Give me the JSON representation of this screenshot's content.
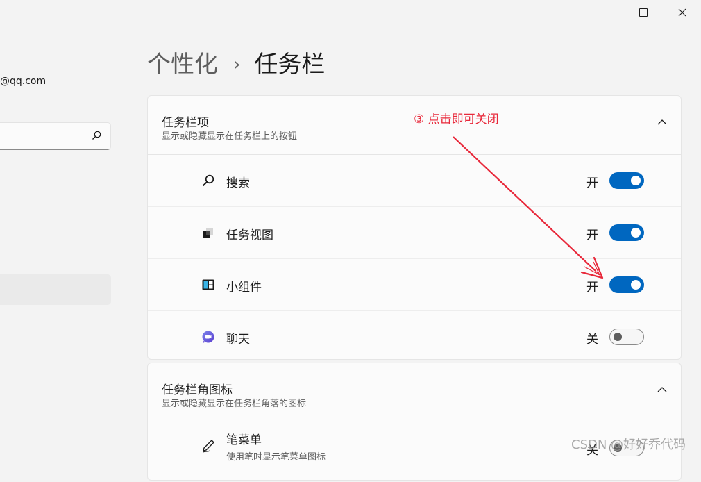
{
  "window": {
    "controls": [
      {
        "name": "minimize-button",
        "icon": "minimize-icon"
      },
      {
        "name": "maximize-button",
        "icon": "maximize-icon"
      },
      {
        "name": "close-button",
        "icon": "close-icon"
      }
    ]
  },
  "sidebar": {
    "account_email": "@qq.com",
    "search_placeholder": "",
    "partial_item": "",
    "selected_item": ""
  },
  "breadcrumb": {
    "parent": "个性化",
    "separator": "›",
    "current": "任务栏"
  },
  "taskbar_items": {
    "title": "任务栏项",
    "subtitle": "显示或隐藏显示在任务栏上的按钮",
    "rows": [
      {
        "label": "搜索",
        "icon": "search-icon",
        "state": "开",
        "on": true
      },
      {
        "label": "任务视图",
        "icon": "task-view-icon",
        "state": "开",
        "on": true
      },
      {
        "label": "小组件",
        "icon": "widgets-icon",
        "state": "开",
        "on": true
      },
      {
        "label": "聊天",
        "icon": "chat-icon",
        "state": "关",
        "on": false
      }
    ]
  },
  "corner_icons": {
    "title": "任务栏角图标",
    "subtitle": "显示或隐藏显示在任务栏角落的图标",
    "rows": [
      {
        "label": "笔菜单",
        "description": "使用笔时显示笔菜单图标",
        "icon": "pen-icon",
        "state": "关",
        "on": false
      }
    ]
  },
  "annotation": {
    "text": "③ 点击即可关闭",
    "color": "#e8283a"
  },
  "watermark": "CSDN @好好乔代码",
  "colors": {
    "accent": "#0067c0",
    "background": "#f3f3f3",
    "card": "#fbfbfb"
  }
}
